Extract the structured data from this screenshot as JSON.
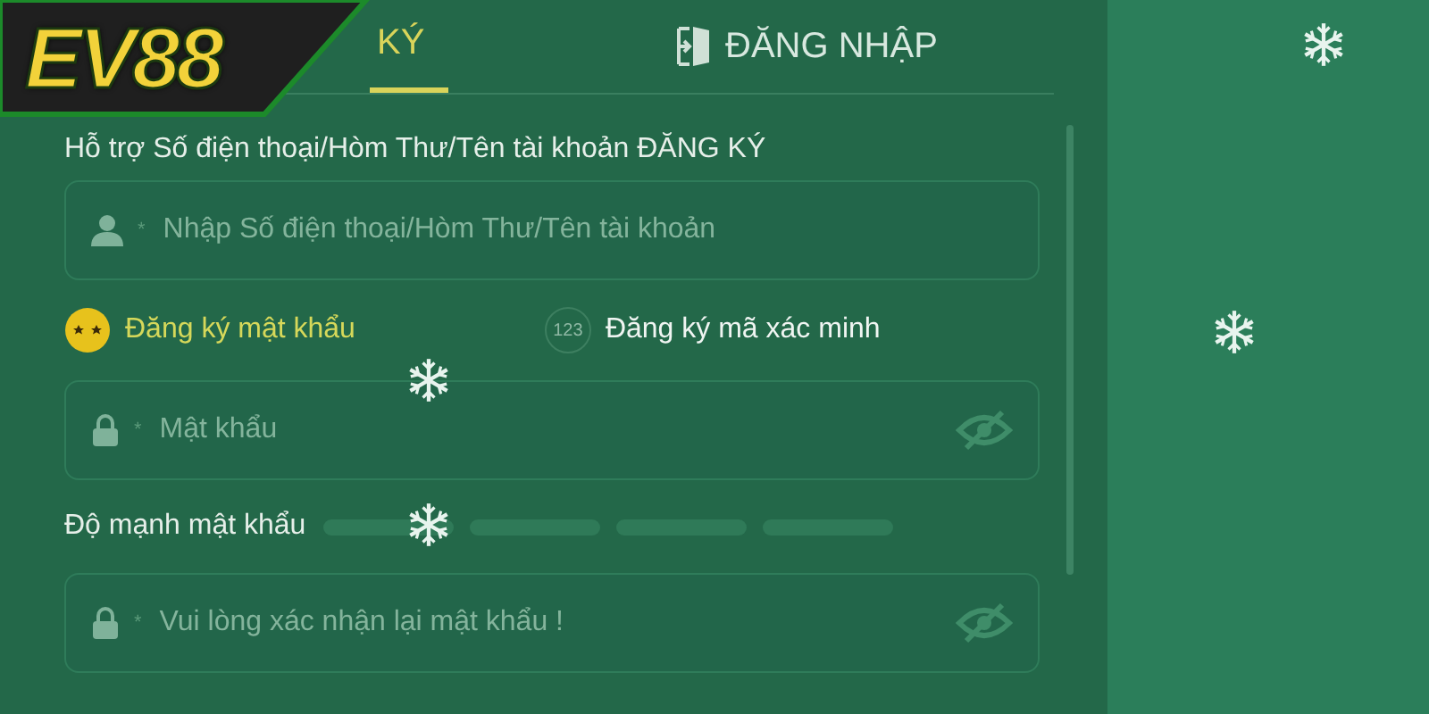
{
  "logo": {
    "text": "EV88"
  },
  "tabs": [
    {
      "label": "KÝ",
      "selected": true,
      "kind": "register"
    },
    {
      "label": "ĐĂNG NHẬP",
      "selected": false,
      "kind": "login"
    }
  ],
  "account": {
    "label": "Hỗ trợ Số điện thoại/Hòm Thư/Tên tài khoản ĐĂNG KÝ",
    "placeholder": "Nhập Số điện thoại/Hòm Thư/Tên tài khoản",
    "mark": "*"
  },
  "methods": [
    {
      "label": "Đăng ký mật khẩu",
      "selected": true,
      "kind": "password"
    },
    {
      "label": "Đăng ký mã xác minh",
      "selected": false,
      "kind": "code",
      "icon_text": "123"
    }
  ],
  "password": {
    "placeholder": "Mật khẩu",
    "mark": "*"
  },
  "strength": {
    "label": "Độ mạnh mật khẩu",
    "level": 0
  },
  "confirm": {
    "placeholder": "Vui lòng xác nhận lại mật khẩu !",
    "mark": "*"
  }
}
